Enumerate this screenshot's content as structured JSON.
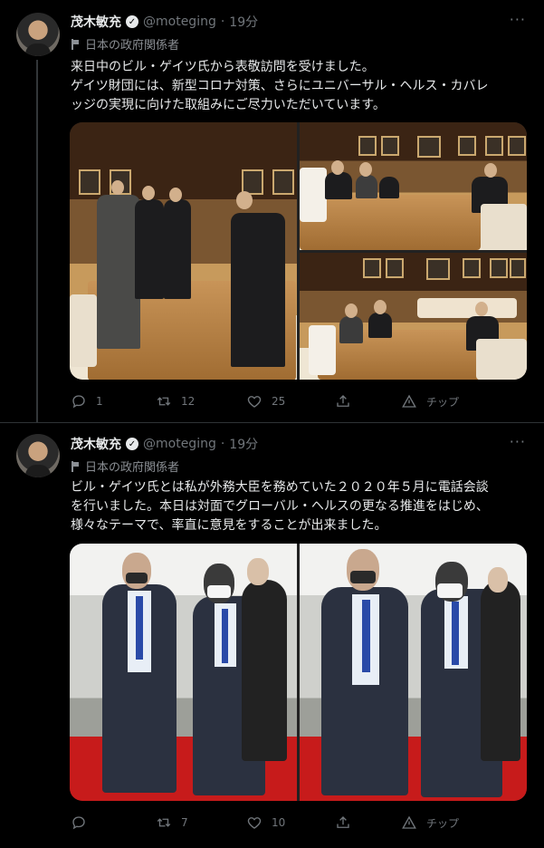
{
  "tweets": [
    {
      "author_name": "茂木敏充",
      "handle": "@moteging",
      "separator": "·",
      "time": "19分",
      "label": "日本の政府関係者",
      "text_lines": [
        "来日中のビル・ゲイツ氏から表敬訪問を受けました。",
        "ゲイツ財団には、新型コロナ対策、さらにユニバーサル・ヘルス・カバレ",
        "ッジの実現に向けた取組みにご尽力いただいています。"
      ],
      "replies": "1",
      "retweets": "12",
      "likes": "25",
      "tip_label": "チップ"
    },
    {
      "author_name": "茂木敏充",
      "handle": "@moteging",
      "separator": "·",
      "time": "19分",
      "label": "日本の政府関係者",
      "text_lines": [
        "ビル・ゲイツ氏とは私が外務大臣を務めていた２０２０年５月に電話会談",
        "を行いました。本日は対面でグローバル・ヘルスの更なる推進をはじめ、",
        "様々なテーマで、率直に意見をすることが出来ました。"
      ],
      "replies": "",
      "retweets": "7",
      "likes": "10",
      "tip_label": "チップ"
    }
  ],
  "icons": {
    "verified": "verified-badge-icon",
    "more": "more-options-icon",
    "label": "flag-icon",
    "reply": "reply-icon",
    "retweet": "retweet-icon",
    "like": "heart-icon",
    "share": "share-icon",
    "tip": "tip-icon"
  },
  "colors": {
    "background": "#000000",
    "text": "#e7e9ea",
    "muted": "#71767b",
    "divider": "#2f3336"
  }
}
